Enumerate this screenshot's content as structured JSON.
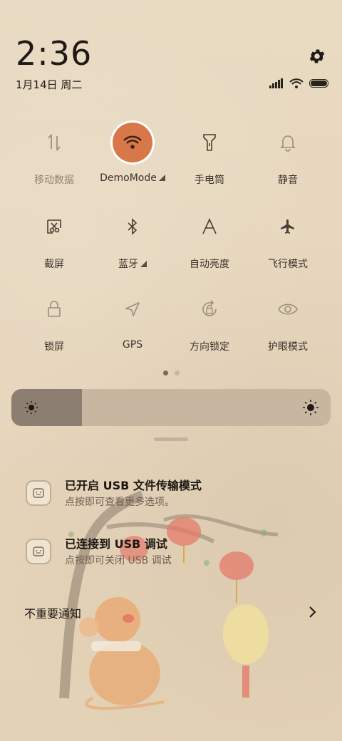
{
  "status": {
    "time": "2:36",
    "date": "1月14日 周二"
  },
  "tiles": [
    {
      "label": "移动数据",
      "icon": "mobile-data-icon"
    },
    {
      "label": "DemoMode",
      "icon": "wifi-icon",
      "active": true
    },
    {
      "label": "手电筒",
      "icon": "flashlight-icon"
    },
    {
      "label": "静音",
      "icon": "bell-icon"
    },
    {
      "label": "截屏",
      "icon": "screenshot-icon"
    },
    {
      "label": "蓝牙",
      "icon": "bluetooth-icon"
    },
    {
      "label": "自动亮度",
      "icon": "auto-brightness-icon"
    },
    {
      "label": "飞行模式",
      "icon": "airplane-icon"
    },
    {
      "label": "锁屏",
      "icon": "lock-icon"
    },
    {
      "label": "GPS",
      "icon": "gps-icon"
    },
    {
      "label": "方向锁定",
      "icon": "rotation-lock-icon"
    },
    {
      "label": "护眼模式",
      "icon": "eye-icon"
    }
  ],
  "brightness": {
    "level": 0.22
  },
  "notifications": [
    {
      "title": "已开启 USB 文件传输模式",
      "subtitle": "点按即可查看更多选项。"
    },
    {
      "title": "已连接到 USB 调试",
      "subtitle": "点按即可关闭 USB 调试"
    }
  ],
  "unimportant_label": "不重要通知",
  "colors": {
    "accent": "#d8784a",
    "background": "#e6d5bb"
  }
}
